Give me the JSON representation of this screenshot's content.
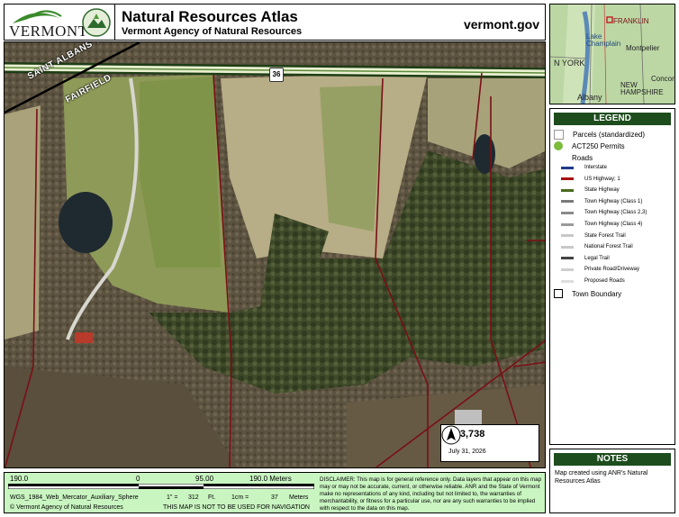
{
  "header": {
    "logo_text": "VERMONT",
    "title": "Natural Resources Atlas",
    "subtitle": "Vermont Agency of Natural Resources",
    "site": "vermont.gov"
  },
  "map": {
    "labels": {
      "saint_albans": "SAINT ALBANS TOWN",
      "fairfield": "FAIRFIELD"
    },
    "route_shield": "36",
    "scale_ratio": "1:  3,738",
    "date": "July 31, 2026"
  },
  "inset": {
    "labels": [
      "FRANKLIN",
      "Lake Champlain",
      "Montpelier",
      "N YORK",
      "NEW HAMPSHIRE",
      "Concord",
      "Albany"
    ]
  },
  "legend": {
    "title": "LEGEND",
    "parcels": "Parcels (standardized)",
    "act250": "ACT250 Permits",
    "roads_heading": "Roads",
    "roads": [
      {
        "label": "Interstate",
        "color": "#1f3a8a"
      },
      {
        "label": "US Highway; 1",
        "color": "#a81010"
      },
      {
        "label": "State Highway",
        "color": "#4a6b1e"
      },
      {
        "label": "Town Highway (Class 1)",
        "color": "#7a7a7a"
      },
      {
        "label": "Town Highway (Class 2,3)",
        "color": "#8a8a8a"
      },
      {
        "label": "Town Highway (Class 4)",
        "color": "#9a9a9a"
      },
      {
        "label": "State Forest Trail",
        "color": "#c8c8c8"
      },
      {
        "label": "National Forest Trail",
        "color": "#c8c8c8"
      },
      {
        "label": "Legal Trail",
        "color": "#444444"
      },
      {
        "label": "Private Road/Driveway",
        "color": "#cfcfcf"
      },
      {
        "label": "Proposed Roads",
        "color": "#dddddd"
      }
    ],
    "town_boundary": "Town Boundary"
  },
  "notes": {
    "title": "NOTES",
    "text": "Map created using ANR's Natural Resources Atlas"
  },
  "footer": {
    "scale_left": "190.0",
    "scale_zero": "0",
    "scale_mid": "95.00",
    "scale_right": "190.0 Meters",
    "projection": "WGS_1984_Web_Mercator_Auxiliary_Sphere",
    "inch_label": "1\" =",
    "inch_value": "312",
    "inch_unit": "Ft.",
    "cm_label": "1cm =",
    "cm_value": "37",
    "cm_unit": "Meters",
    "copyright": "© Vermont Agency of Natural Resources",
    "navigation_warning": "THIS MAP IS NOT TO BE USED FOR NAVIGATION",
    "disclaimer": "DISCLAIMER: This map is for general reference only. Data layers that appear on this map may or may not be accurate, current, or otherwise reliable. ANR and the State of Vermont make no representations of any kind, including but not limited to, the warranties of merchantability, or fitness for a particular use, nor are any such warranties to be implied with respect to the data on this map."
  },
  "colors": {
    "legend_header": "#1d4d1d",
    "footer_bg": "#c9f5c1",
    "parcel_line": "#7a0f16",
    "road": "#e8f0d0"
  }
}
